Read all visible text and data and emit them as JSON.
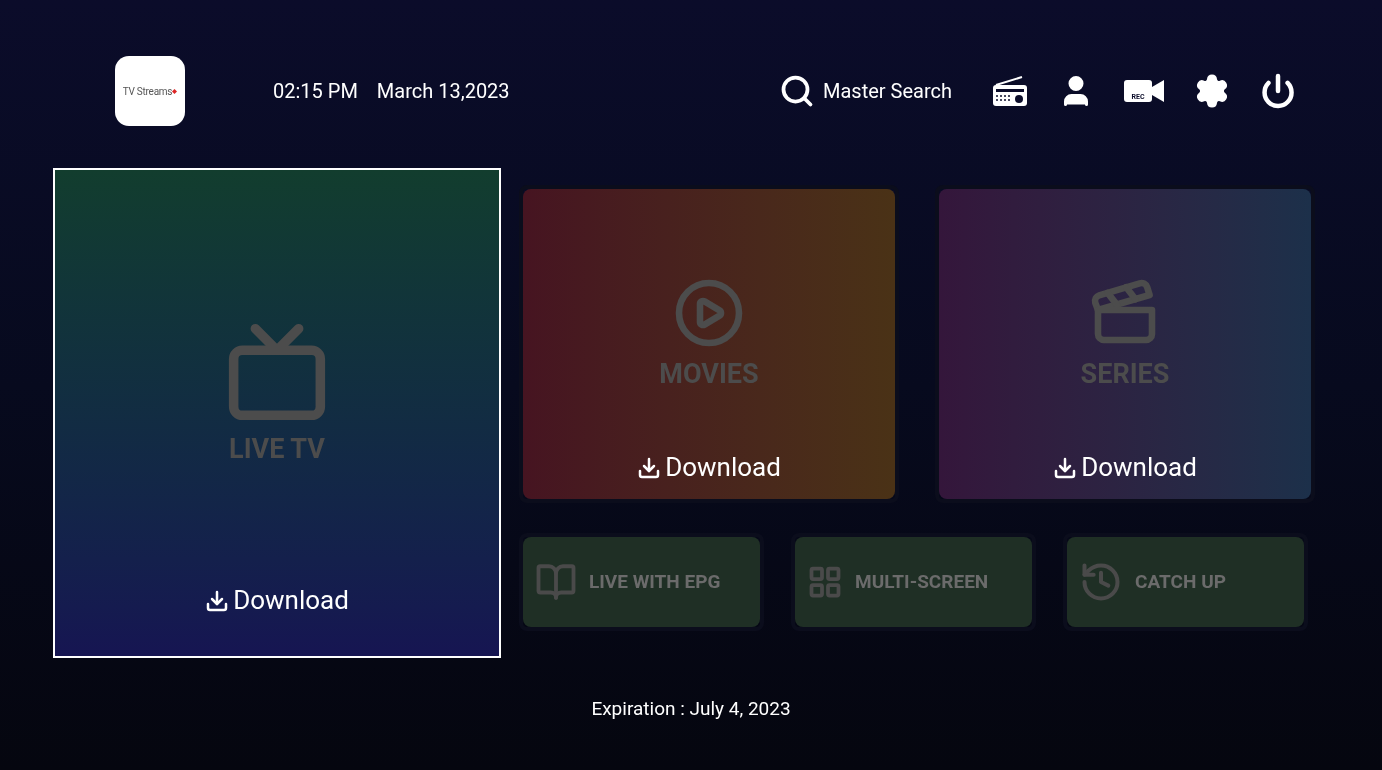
{
  "header": {
    "logo_text": "TV Streams",
    "time": "02:15 PM",
    "date": "March 13,2023",
    "search_label": "Master Search",
    "rec_label": "REC"
  },
  "main_tiles": [
    {
      "kind": "live",
      "label": "LIVE TV",
      "download": "Download",
      "selected": true
    },
    {
      "kind": "movies",
      "label": "MOVIES",
      "download": "Download",
      "selected": false
    },
    {
      "kind": "series",
      "label": "SERIES",
      "download": "Download",
      "selected": false
    }
  ],
  "small_tiles": [
    {
      "kind": "epg",
      "label": "LIVE WITH EPG",
      "selected": false
    },
    {
      "kind": "multi",
      "label": "MULTI-SCREEN",
      "selected": false
    },
    {
      "kind": "catchup",
      "label": "CATCH UP",
      "selected": false
    }
  ],
  "footer": {
    "expiration": "Expiration : July 4, 2023"
  }
}
